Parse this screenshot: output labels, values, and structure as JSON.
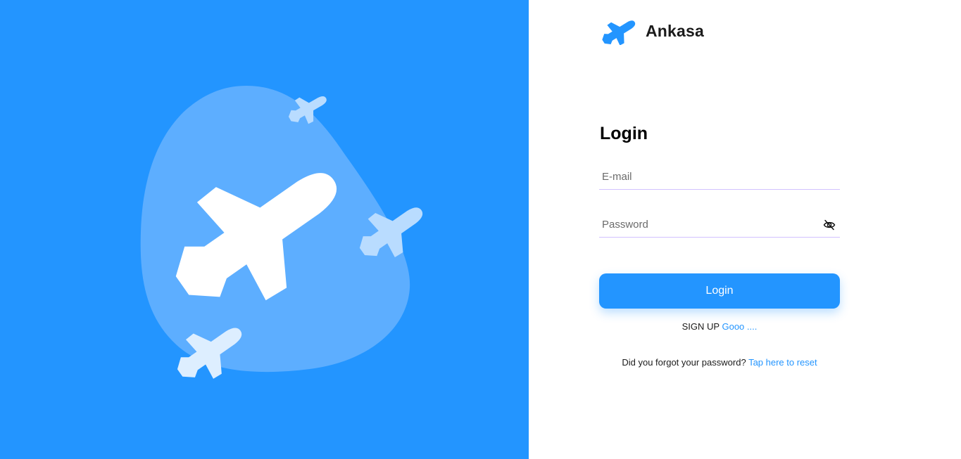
{
  "brand": {
    "name": "Ankasa",
    "icon": "plane-logo-icon"
  },
  "form": {
    "title": "Login",
    "email_placeholder": "E-mail",
    "password_placeholder": "Password",
    "password_toggle_icon": "eye-slash-icon",
    "submit_label": "Login"
  },
  "signup": {
    "text": "SIGN UP",
    "link": "Gooo ...."
  },
  "forgot": {
    "text": "Did you forgot your password?",
    "link": "Tap here to reset"
  },
  "colors": {
    "accent": "#2395ff",
    "blob": "#5daeff",
    "plane_large": "#ffffff",
    "plane_small": "#b9dcff"
  }
}
